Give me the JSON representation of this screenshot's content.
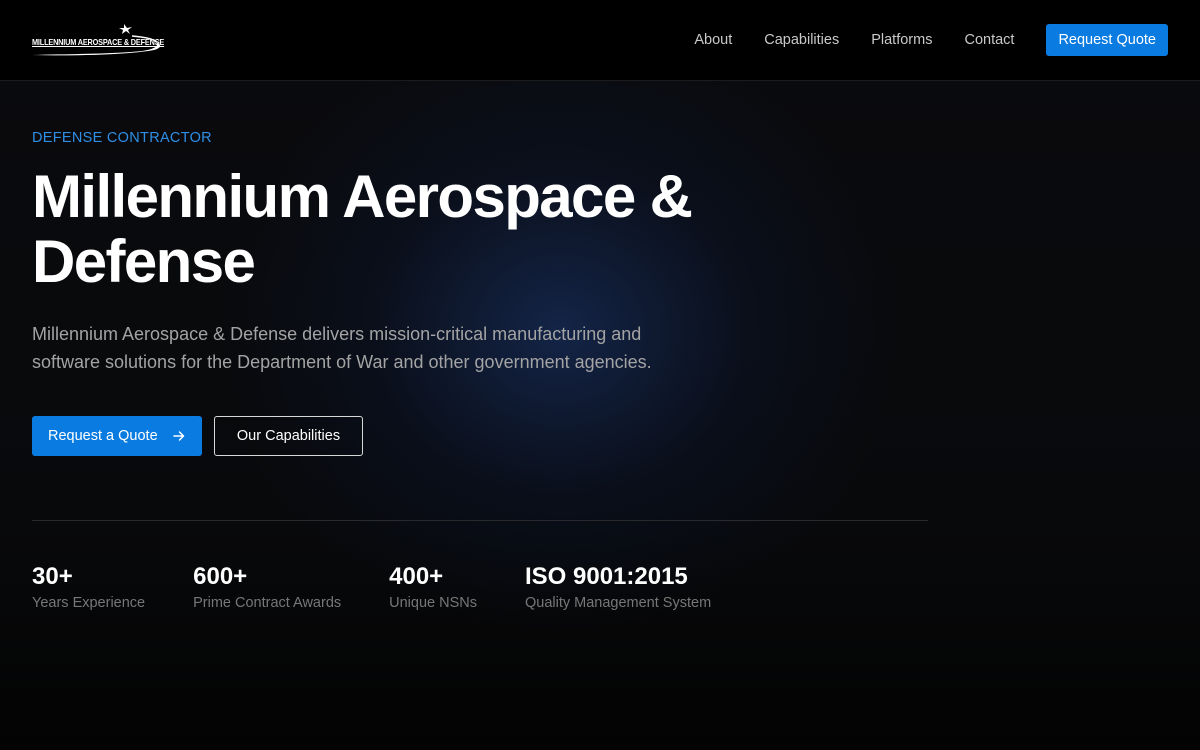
{
  "brand": {
    "logo_text": "MILLENNIUM AEROSPACE & DEFENSE",
    "logo_icon": "jet-icon"
  },
  "nav": {
    "links": [
      "About",
      "Capabilities",
      "Platforms",
      "Contact"
    ],
    "cta": "Request Quote"
  },
  "hero": {
    "eyebrow": "DEFENSE CONTRACTOR",
    "title": "Millennium Aerospace & Defense",
    "subtitle": "Millennium Aerospace & Defense delivers mission-critical manufacturing and software solutions for the Department of War and other government agencies.",
    "primary_button": "Request a Quote",
    "primary_button_icon": "arrow-right-icon",
    "secondary_button": "Our Capabilities"
  },
  "stats": [
    {
      "value": "30+",
      "label": "Years Experience"
    },
    {
      "value": "600+",
      "label": "Prime Contract Awards"
    },
    {
      "value": "400+",
      "label": "Unique NSNs"
    },
    {
      "value": "ISO 9001:2015",
      "label": "Quality Management System"
    }
  ],
  "colors": {
    "accent": "#0a7be0",
    "eyebrow": "#2f8fe6",
    "background": "#060606",
    "header": "#000000",
    "muted_text": "#a3a3a3"
  }
}
